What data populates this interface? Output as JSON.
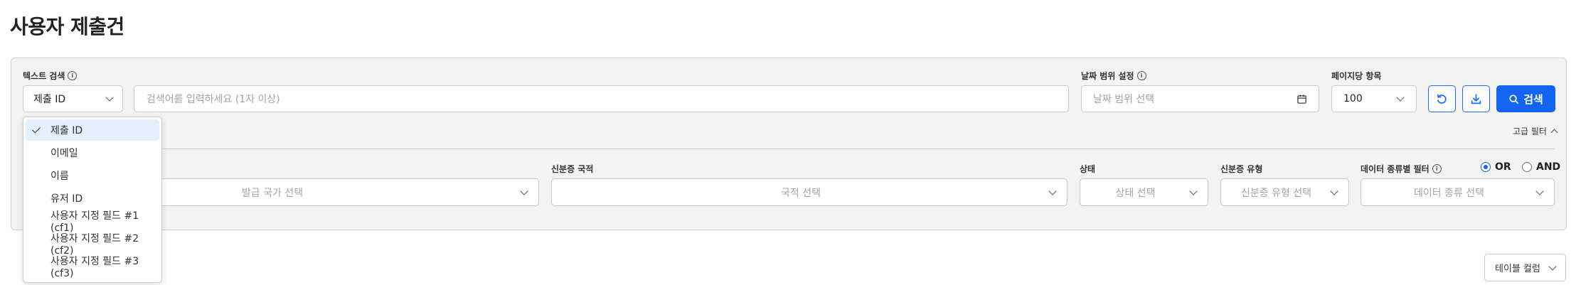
{
  "page": {
    "title": "사용자 제출건"
  },
  "text_search": {
    "label": "텍스트 검색",
    "selected": "제출 ID",
    "placeholder": "검색어를 입력하세요 (1자 이상)",
    "options": [
      "제출 ID",
      "이메일",
      "이름",
      "유저 ID",
      "사용자 지정 필드 #1 (cf1)",
      "사용자 지정 필드 #2 (cf2)",
      "사용자 지정 필드 #3 (cf3)"
    ]
  },
  "date_range": {
    "label": "날짜 범위 설정",
    "placeholder": "날짜 범위 선택"
  },
  "per_page": {
    "label": "페이지당 항목",
    "value": "100"
  },
  "actions": {
    "search_label": "검색"
  },
  "advanced": {
    "toggle_label": "고급 필터"
  },
  "filters": {
    "issue_country": {
      "placeholder": "발급 국가 선택"
    },
    "nationality": {
      "label": "신분증 국적",
      "placeholder": "국적 선택"
    },
    "status": {
      "label": "상태",
      "placeholder": "상태 선택"
    },
    "id_type": {
      "label": "신분증 유형",
      "placeholder": "신분증 유형 선택"
    },
    "data_type": {
      "label": "데이터 종류별 필터",
      "placeholder": "데이터 종류 선택"
    },
    "logic": {
      "or_label": "OR",
      "and_label": "AND",
      "selected": "OR"
    }
  },
  "table": {
    "columns_button": "테이블 컬럼"
  },
  "colors": {
    "accent": "#1464f4",
    "selected_bg": "#e5effd"
  },
  "icons": [
    "info-icon",
    "chevron-down-icon",
    "calendar-icon",
    "refresh-icon",
    "download-icon",
    "search-icon",
    "chevron-up-icon",
    "check-icon"
  ]
}
